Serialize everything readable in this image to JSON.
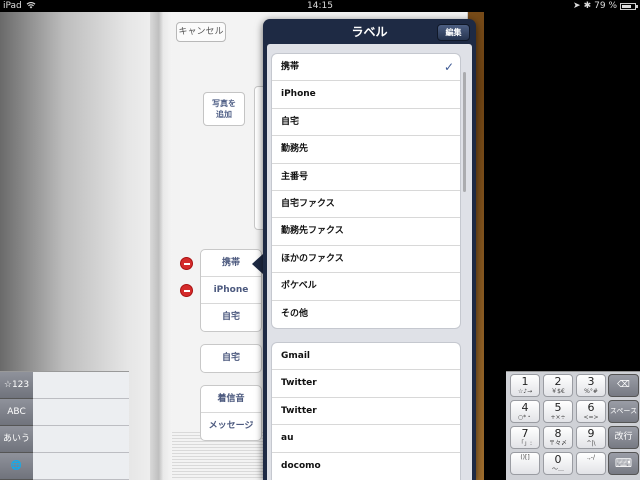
{
  "status": {
    "device": "iPad",
    "time": "14:15",
    "battery": "79 %",
    "battery_level": 0.79
  },
  "contact_form": {
    "cancel_label": "キャンセル",
    "photo_label_1": "写真を",
    "photo_label_2": "追加",
    "phone_labels": [
      "携帯",
      "iPhone",
      "自宅"
    ],
    "email_label": "自宅",
    "ringtone_label": "着信音",
    "message_label": "メッセージ"
  },
  "popover": {
    "title": "ラベル",
    "edit_label": "編集",
    "selected_check": "✓",
    "labels": [
      "携帯",
      "iPhone",
      "自宅",
      "勤務先",
      "主番号",
      "自宅ファクス",
      "勤務先ファクス",
      "ほかのファクス",
      "ポケベル",
      "その他"
    ],
    "custom_labels": [
      "Gmail",
      "Twitter",
      "Twitter",
      "au",
      "docomo"
    ]
  },
  "keyboard": {
    "left_keys": [
      "☆123",
      "ABC",
      "あいう",
      "🌐"
    ],
    "keys": [
      {
        "big": "1",
        "small": "☆♪→"
      },
      {
        "big": "2",
        "small": "￥$€"
      },
      {
        "big": "3",
        "small": "%°#"
      },
      {
        "big": "4",
        "small": "○*・"
      },
      {
        "big": "5",
        "small": "+×÷"
      },
      {
        "big": "6",
        "small": "<=>"
      },
      {
        "big": "7",
        "small": "「」:"
      },
      {
        "big": "8",
        "small": "〒々〆"
      },
      {
        "big": "9",
        "small": "^|\\"
      },
      {
        "big": "",
        "small": "()[]"
      },
      {
        "big": "0",
        "small": "〜…"
      },
      {
        "big": "",
        "small": ".,-/"
      }
    ],
    "delete_icon": "⌫",
    "space_label": "スペース",
    "return_label": "改行",
    "hide_icon": "⌨"
  }
}
